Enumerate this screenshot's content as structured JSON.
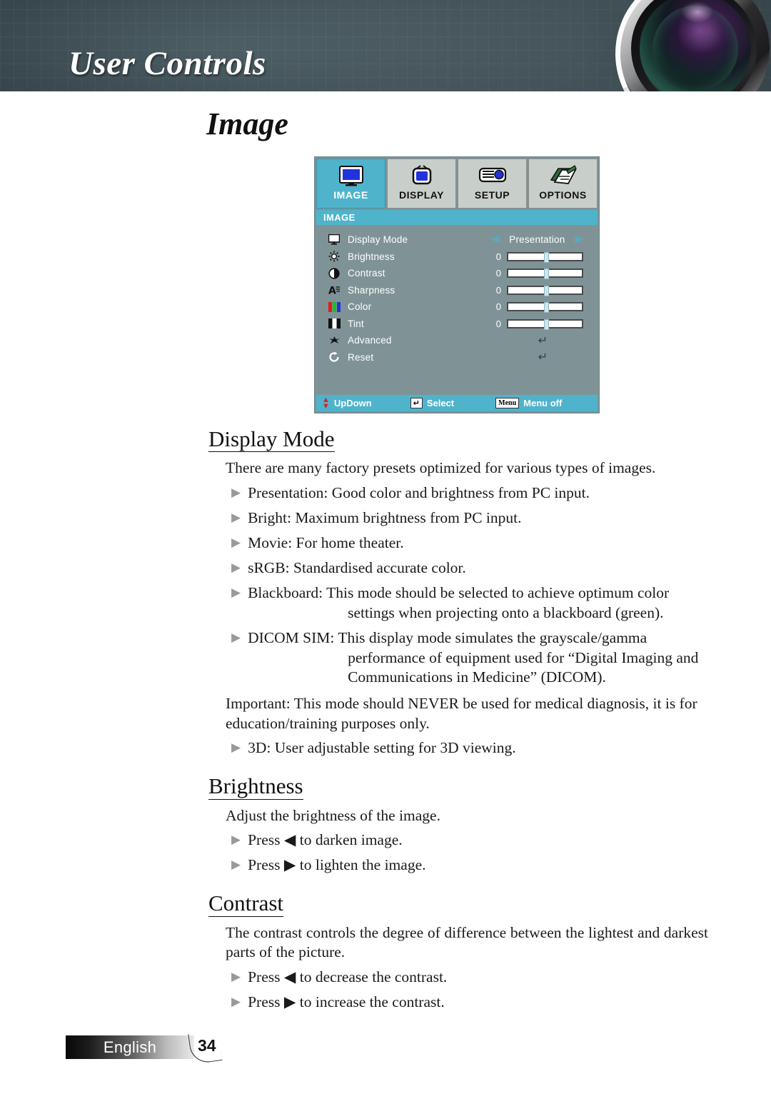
{
  "header": {
    "title": "User Controls",
    "lens_icon": "projector-lens-graphic"
  },
  "page_title": "Image",
  "osd": {
    "tabs": [
      {
        "label": "IMAGE",
        "icon": "monitor-icon",
        "active": true
      },
      {
        "label": "DISPLAY",
        "icon": "tv-icon",
        "active": false
      },
      {
        "label": "SETUP",
        "icon": "projector-icon",
        "active": false
      },
      {
        "label": "OPTIONS",
        "icon": "notepad-pencil-icon",
        "active": false
      }
    ],
    "section_label": "IMAGE",
    "rows": [
      {
        "label": "Display Mode",
        "icon": "monitor-small-icon",
        "type": "choice",
        "value": "Presentation"
      },
      {
        "label": "Brightness",
        "icon": "sun-icon",
        "type": "slider",
        "value": "0",
        "position": 50
      },
      {
        "label": "Contrast",
        "icon": "half-circle-icon",
        "type": "slider",
        "value": "0",
        "position": 50
      },
      {
        "label": "Sharpness",
        "icon": "letter-a-icon",
        "type": "slider",
        "value": "0",
        "position": 50
      },
      {
        "label": "Color",
        "icon": "rgb-bars-icon",
        "type": "slider",
        "value": "0",
        "position": 50
      },
      {
        "label": "Tint",
        "icon": "bw-bars-icon",
        "type": "slider",
        "value": "0",
        "position": 50
      },
      {
        "label": "Advanced",
        "icon": "star-icon",
        "type": "enter",
        "value": "↵"
      },
      {
        "label": "Reset",
        "icon": "refresh-icon",
        "type": "enter",
        "value": "↵"
      }
    ],
    "footer": {
      "updown_label": "UpDown",
      "select_label": "Select",
      "select_key": "↵",
      "menuoff_label": "Menu off",
      "menu_key": "Menu"
    },
    "colors": {
      "accent_cyan": "#4fb3cc",
      "body_bg": "#7f9397",
      "tab_inactive": "#c8cfcb"
    }
  },
  "sections": [
    {
      "heading": "Display Mode",
      "intro": "There are many factory presets optimized for various types of images.",
      "bullets": [
        {
          "text": "Presentation: Good color and brightness from PC input."
        },
        {
          "text": "Bright: Maximum brightness from PC input."
        },
        {
          "text": "Movie: For home theater."
        },
        {
          "text": "sRGB: Standardised accurate color."
        },
        {
          "text": "Blackboard: This mode should be selected to achieve optimum color",
          "cont": "settings when projecting onto a blackboard (green)."
        },
        {
          "text": "DICOM SIM: This display mode simulates the grayscale/gamma",
          "cont": "performance of equipment used for “Digital Imaging and Communications in Medicine” (DICOM)."
        }
      ],
      "important": "Important: This mode should NEVER be used for medical diagnosis, it is for education/training purposes only.",
      "bullets_after": [
        {
          "text": "3D: User adjustable setting for 3D viewing."
        }
      ]
    },
    {
      "heading": "Brightness",
      "intro": "Adjust the brightness of the image.",
      "bullets": [
        {
          "text": "Press ◀ to darken image."
        },
        {
          "text": "Press ▶ to lighten the image."
        }
      ]
    },
    {
      "heading": "Contrast",
      "intro": "The contrast controls the degree of difference between the lightest and darkest parts of the picture.",
      "bullets": [
        {
          "text": "Press ◀ to decrease the contrast."
        },
        {
          "text": "Press ▶ to increase the contrast."
        }
      ]
    }
  ],
  "footer": {
    "language": "English",
    "page_number": "34"
  }
}
